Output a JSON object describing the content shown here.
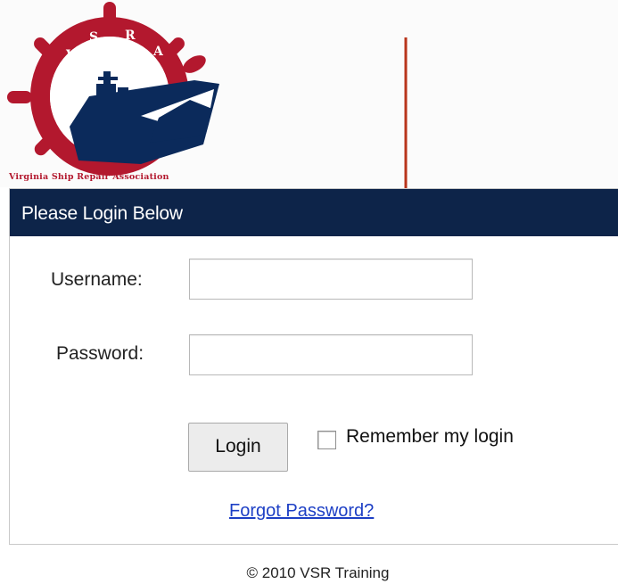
{
  "logo": {
    "letters": [
      "V",
      "S",
      "R",
      "A"
    ],
    "caption": "Virginia Ship Repair Association",
    "colors": {
      "wheel": "#b3182e",
      "ship": "#0b2a5b",
      "caption": "#b3182e"
    }
  },
  "panel": {
    "header": "Please Login Below",
    "header_bg": "#0d2449"
  },
  "form": {
    "username_label": "Username:",
    "username_value": "",
    "password_label": "Password:",
    "password_value": "",
    "login_button": "Login",
    "remember_label": "Remember my login",
    "remember_checked": false,
    "forgot_link": "Forgot Password?"
  },
  "annotation": {
    "arrow_color": "#b8341b"
  },
  "footer": {
    "text": "© 2010 VSR Training"
  }
}
